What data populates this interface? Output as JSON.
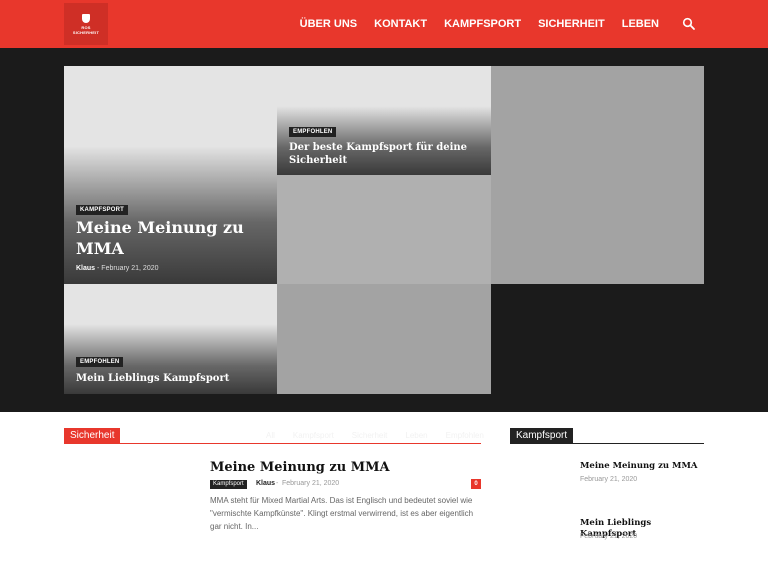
{
  "header": {
    "logo": {
      "line1": "ROS",
      "line2": "SICHERHEIT"
    },
    "nav": [
      "ÜBER UNS",
      "KONTAKT",
      "KAMPFSPORT",
      "SICHERHEIT",
      "LEBEN"
    ],
    "search_icon": "search-icon"
  },
  "hero": {
    "main": {
      "category": "KAMPFSPORT",
      "title": "Meine Meinung zu MMA",
      "author": "Klaus",
      "date": "February 21, 2020"
    },
    "top_right": {
      "category": "EMPFOHLEN",
      "title": "Der beste Kampfsport für deine Sicherheit"
    },
    "bottom_left": {
      "category": "EMPFOHLEN",
      "title": "Mein Lieblings Kampfsport"
    }
  },
  "section_left": {
    "label": "Sicherheit",
    "filters": [
      "All",
      "Kampfsport",
      "Sicherheit",
      "Leben",
      "Empfohlen"
    ],
    "post": {
      "title": "Meine Meinung zu MMA",
      "category": "Kampfsport",
      "author": "Klaus",
      "date": "February 21, 2020",
      "comments": "0",
      "excerpt": "MMA steht für Mixed Martial Arts. Das ist Englisch und bedeutet soviel wie \"vermischte Kampfkünste\". Klingt erstmal verwirrend, ist es aber eigentlich gar nicht. In..."
    }
  },
  "section_right": {
    "label": "Kampfsport",
    "posts": [
      {
        "title": "Meine Meinung zu MMA",
        "date": "February 21, 2020"
      },
      {
        "title": "Mein Lieblings Kampfsport",
        "date": "February 21, 2020"
      }
    ]
  },
  "colors": {
    "brand_red": "#e8372c",
    "dark": "#1b1b1b",
    "label_dark": "#222222"
  }
}
